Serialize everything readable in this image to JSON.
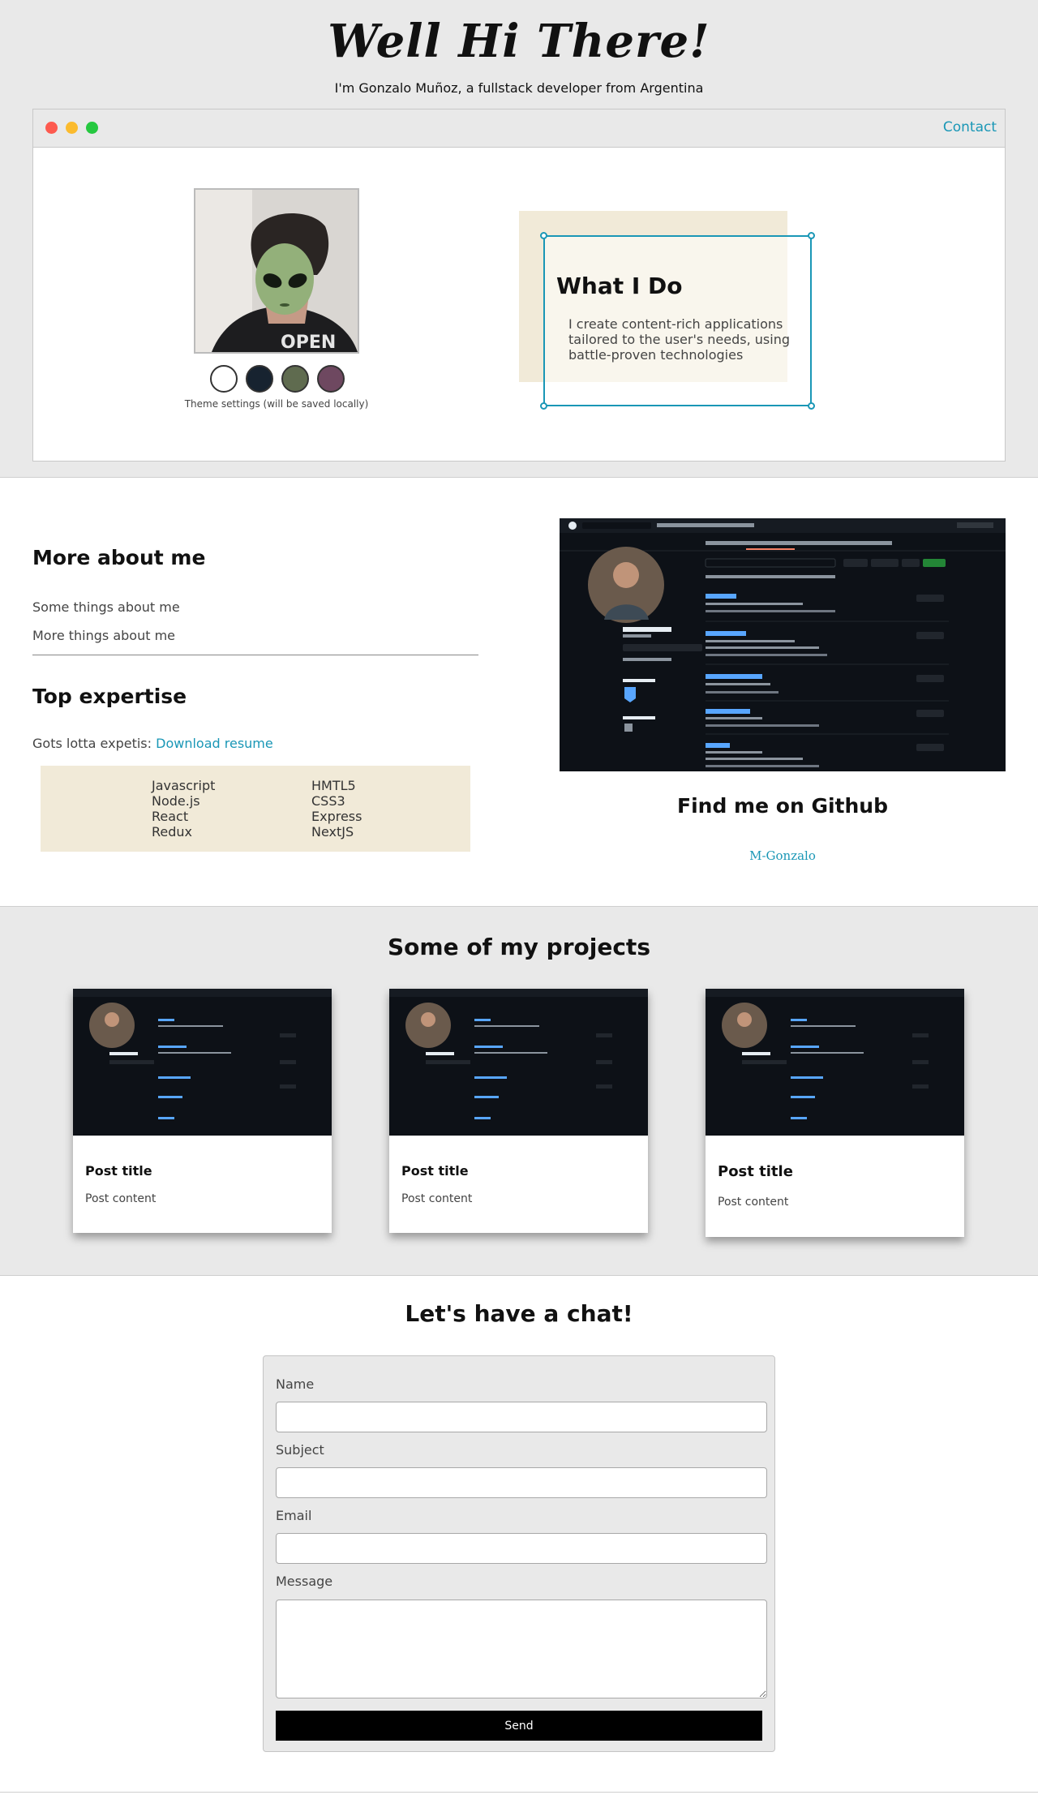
{
  "hero": {
    "title": "Well Hi There!",
    "subtitle": "I'm Gonzalo Muñoz, a fullstack developer from Argentina"
  },
  "browser": {
    "contact_label": "Contact",
    "theme_note": "Theme settings (will be saved locally)",
    "theme_swatches": [
      "#ffffff",
      "#172330",
      "#5f6b4f",
      "#6e4860"
    ],
    "what_title": "What I Do",
    "what_text": "I create content-rich applications tailored to the user's needs, using battle-proven technologies"
  },
  "about": {
    "heading": "More about me",
    "lines": [
      "Some things about me",
      "More things about me"
    ],
    "expertise_heading": "Top expertise",
    "expertise_prefix": "Gots lotta expetis:",
    "resume_link": "Download resume",
    "skills_left": [
      "Javascript",
      "Node.js",
      "React",
      "Redux"
    ],
    "skills_right": [
      "HMTL5",
      "CSS3",
      "Express",
      "NextJS"
    ]
  },
  "github": {
    "heading": "Find me on Github",
    "username_link": "M-Gonzalo"
  },
  "projects": {
    "heading": "Some of my projects",
    "cards": [
      {
        "title": "Post title",
        "content": "Post content"
      },
      {
        "title": "Post title",
        "content": "Post content"
      },
      {
        "title": "Post title",
        "content": "Post content"
      }
    ]
  },
  "chat": {
    "heading": "Let's have a chat!",
    "name_label": "Name",
    "subject_label": "Subject",
    "email_label": "Email",
    "message_label": "Message",
    "send_label": "Send"
  },
  "colors": {
    "accent": "#1a97b6",
    "panel": "#e9e9e9",
    "cream": "#f1ead8"
  }
}
